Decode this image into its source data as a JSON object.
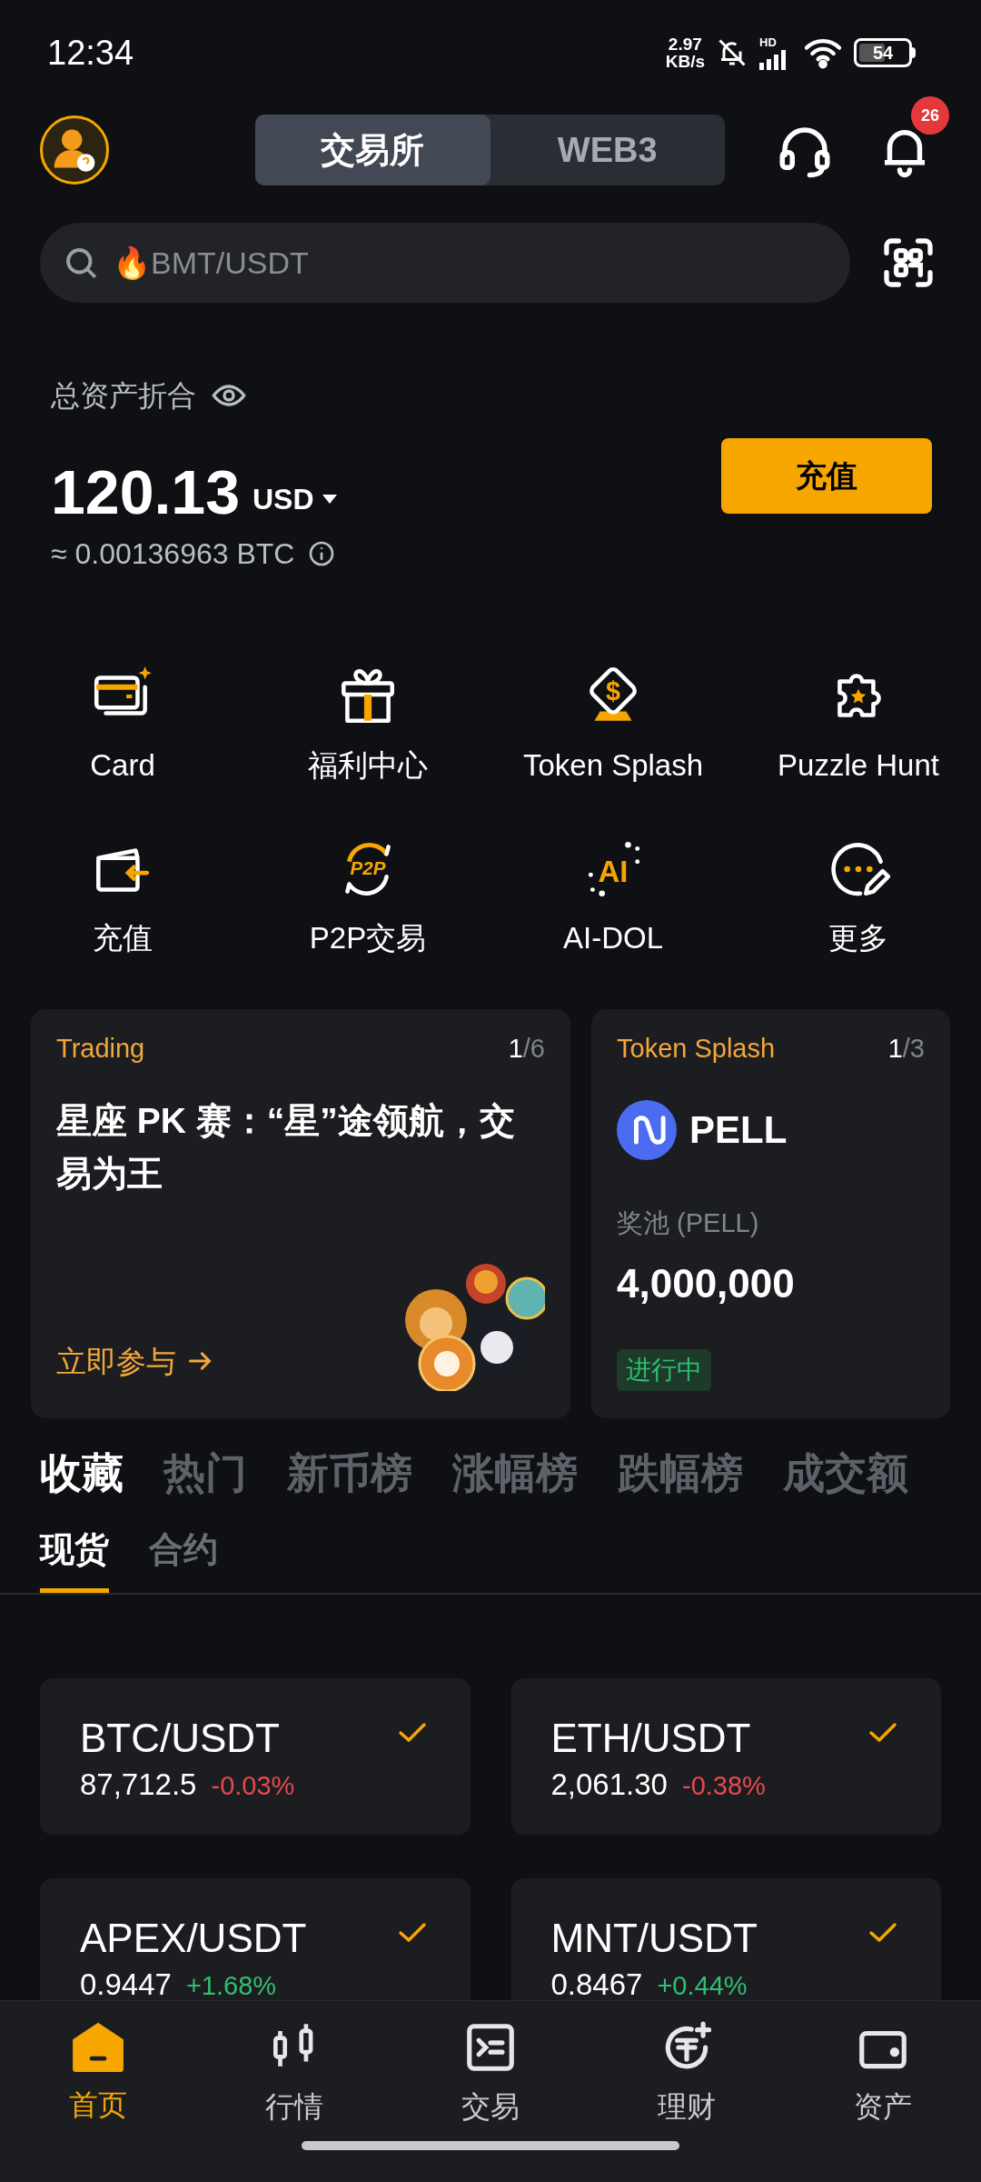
{
  "status_bar": {
    "time": "12:34",
    "net_speed": "2.97",
    "net_unit": "KB/s",
    "signal_label": "HD",
    "battery": "54"
  },
  "header": {
    "tabs": [
      {
        "label": "交易所",
        "selected": true
      },
      {
        "label": "WEB3",
        "selected": false
      }
    ],
    "notification_badge": "26"
  },
  "search": {
    "placeholder": "🔥BMT/USDT"
  },
  "assets": {
    "title": "总资产折合",
    "amount": "120.13",
    "currency": "USD",
    "btc_equivalent": "≈ 0.00136963 BTC",
    "deposit_button": "充值"
  },
  "shortcuts": [
    {
      "label": "Card",
      "kind": "card"
    },
    {
      "label": "福利中心",
      "kind": "gift"
    },
    {
      "label": "Token Splash",
      "kind": "coin",
      "icon_text": "$"
    },
    {
      "label": "Puzzle Hunt",
      "kind": "puzzle"
    },
    {
      "label": "充值",
      "kind": "deposit"
    },
    {
      "label": "P2P交易",
      "kind": "p2p",
      "icon_text": "P2P"
    },
    {
      "label": "AI-DOL",
      "kind": "ai",
      "icon_text": "AI"
    },
    {
      "label": "更多",
      "kind": "more"
    }
  ],
  "promos": [
    {
      "kind": "event",
      "category": "Trading",
      "page": "1",
      "total": "/6",
      "title": "星座 PK 赛：“星”途领航，交易为王",
      "link": "立即参与"
    },
    {
      "kind": "token",
      "category": "Token Splash",
      "page": "1",
      "total": "/3",
      "token": "PELL",
      "pool_label": "奖池 (PELL)",
      "pool_amount": "4,000,000",
      "status": "进行中"
    }
  ],
  "market_tabs": [
    {
      "label": "收藏",
      "selected": true
    },
    {
      "label": "热门",
      "selected": false
    },
    {
      "label": "新币榜",
      "selected": false
    },
    {
      "label": "涨幅榜",
      "selected": false
    },
    {
      "label": "跌幅榜",
      "selected": false
    },
    {
      "label": "成交额",
      "selected": false
    }
  ],
  "sub_tabs": [
    {
      "label": "现货",
      "selected": true
    },
    {
      "label": "合约",
      "selected": false
    }
  ],
  "favorites": [
    {
      "pair": "BTC/USDT",
      "price": "87,712.5",
      "change": "-0.03%",
      "color": "#e5484d",
      "checked": true
    },
    {
      "pair": "ETH/USDT",
      "price": "2,061.30",
      "change": "-0.38%",
      "color": "#e5484d",
      "checked": true
    },
    {
      "pair": "APEX/USDT",
      "price": "0.9447",
      "change": "+1.68%",
      "color": "#2fbf71",
      "checked": true
    },
    {
      "pair": "MNT/USDT",
      "price": "0.8467",
      "change": "+0.44%",
      "color": "#2fbf71",
      "checked": true
    }
  ],
  "nav": [
    {
      "label": "首页",
      "kind": "home",
      "selected": true
    },
    {
      "label": "行情",
      "kind": "candles",
      "selected": false
    },
    {
      "label": "交易",
      "kind": "trade",
      "selected": false
    },
    {
      "label": "理财",
      "kind": "earn",
      "selected": false
    },
    {
      "label": "资产",
      "kind": "wallet",
      "selected": false
    }
  ]
}
